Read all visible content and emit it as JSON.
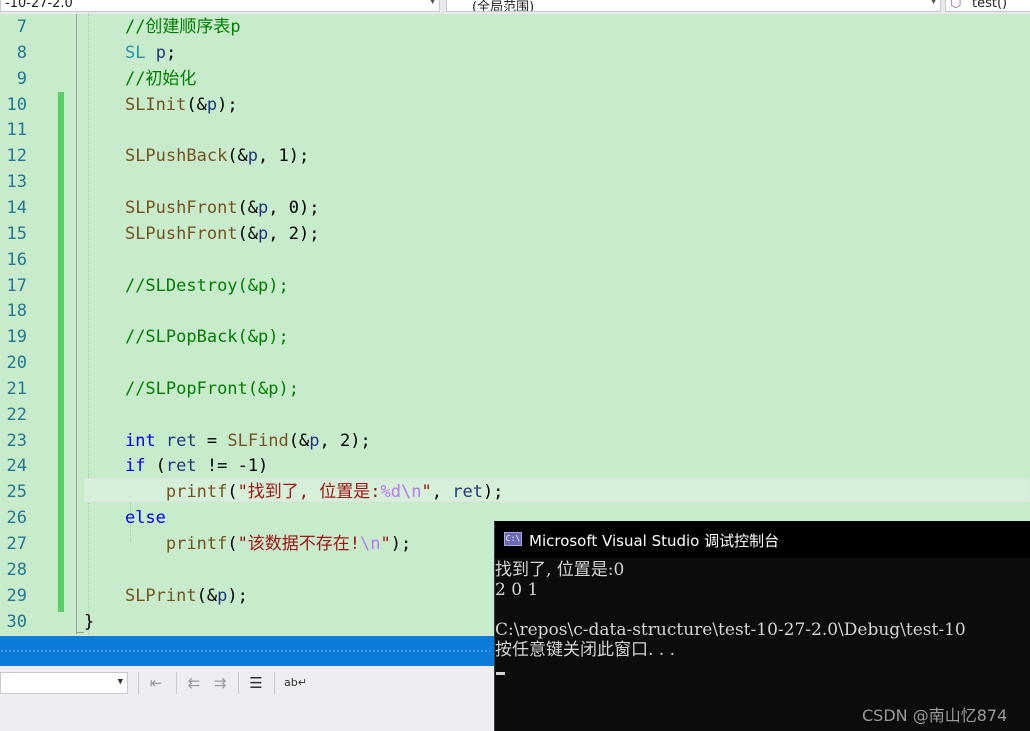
{
  "nav": {
    "project_dropdown": "-10-27-2.0",
    "scope_dropdown": "(全局范围)",
    "member_dropdown": "test()"
  },
  "editor": {
    "lines": [
      {
        "n": "7",
        "code": "    //创建顺序表p"
      },
      {
        "n": "8",
        "code": "    SL p;"
      },
      {
        "n": "9",
        "code": "    //初始化"
      },
      {
        "n": "10",
        "code": "    SLInit(&p);"
      },
      {
        "n": "11",
        "code": ""
      },
      {
        "n": "12",
        "code": "    SLPushBack(&p, 1);"
      },
      {
        "n": "13",
        "code": ""
      },
      {
        "n": "14",
        "code": "    SLPushFront(&p, 0);"
      },
      {
        "n": "15",
        "code": "    SLPushFront(&p, 2);"
      },
      {
        "n": "16",
        "code": ""
      },
      {
        "n": "17",
        "code": "    //SLDestroy(&p);"
      },
      {
        "n": "18",
        "code": ""
      },
      {
        "n": "19",
        "code": "    //SLPopBack(&p);"
      },
      {
        "n": "20",
        "code": ""
      },
      {
        "n": "21",
        "code": "    //SLPopFront(&p);"
      },
      {
        "n": "22",
        "code": ""
      },
      {
        "n": "23",
        "code": "    int ret = SLFind(&p, 2);"
      },
      {
        "n": "24",
        "code": "    if (ret != -1)"
      },
      {
        "n": "25",
        "code": "        printf(\"找到了, 位置是:%d\\n\", ret);"
      },
      {
        "n": "26",
        "code": "    else"
      },
      {
        "n": "27",
        "code": "        printf(\"该数据不存在!\\n\");"
      },
      {
        "n": "28",
        "code": ""
      },
      {
        "n": "29",
        "code": "    SLPrint(&p);"
      },
      {
        "n": "30",
        "code": "}"
      }
    ]
  },
  "toolbar": {
    "icons": [
      "outdent-icon",
      "decrease-indent-icon",
      "increase-indent-icon",
      "error-list-icon",
      "word-wrap-icon"
    ]
  },
  "console": {
    "title": "Microsoft Visual Studio 调试控制台",
    "icon_label": "C:\\",
    "output": [
      "找到了, 位置是:0",
      "2 0 1",
      "",
      "C:\\repos\\c-data-structure\\test-10-27-2.0\\Debug\\test-10",
      "按任意键关闭此窗口. . ."
    ]
  },
  "watermark": "CSDN @南山忆874",
  "colors": {
    "editor_bg": "#c8ebcc",
    "change_bar": "#57d163",
    "line_number": "#237893",
    "comment": "#008000",
    "keyword": "#0000ff",
    "function": "#74531f",
    "variable": "#1f377f",
    "string": "#a31515",
    "escape": "#b776fb",
    "status_bar": "#0c7bd8",
    "console_bg": "#0c0c0c"
  }
}
